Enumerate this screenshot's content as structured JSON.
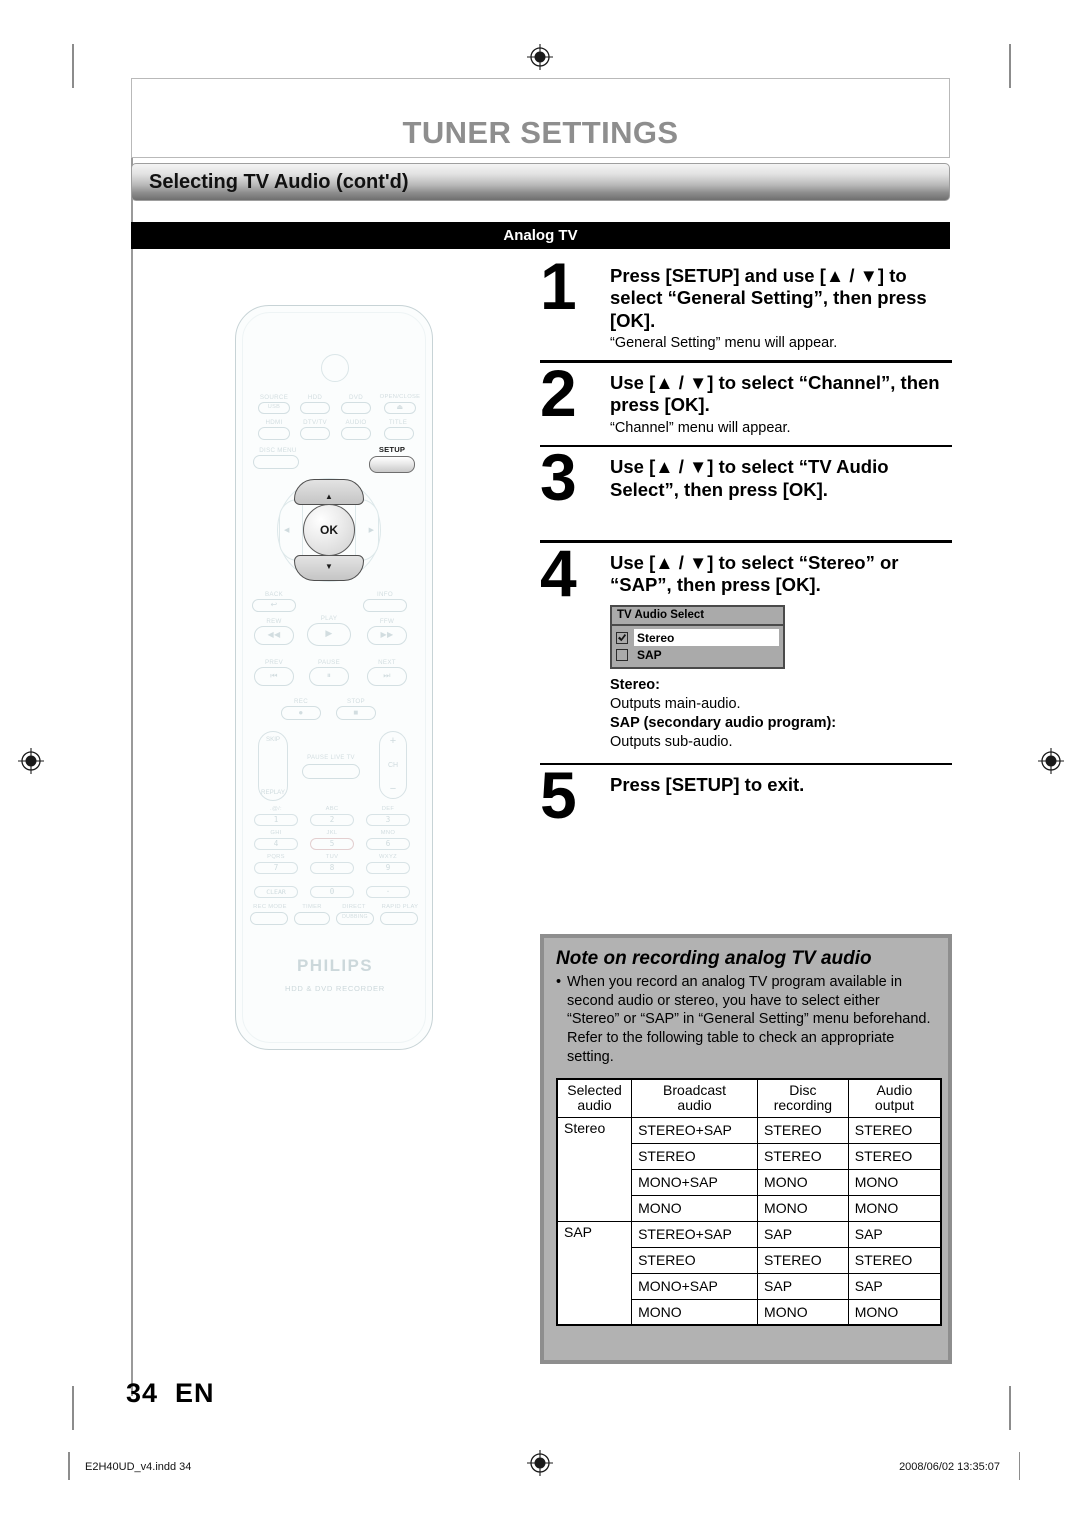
{
  "page": {
    "title": "TUNER SETTINGS",
    "subtitle": "Selecting TV Audio (cont'd)",
    "section": "Analog TV",
    "page_number": "34",
    "language_code": "EN"
  },
  "steps": [
    {
      "num": "1",
      "title": "Press [SETUP] and use [▲ / ▼] to select “General Setting”, then press [OK].",
      "sub": "“General Setting” menu will appear."
    },
    {
      "num": "2",
      "title": "Use [▲ / ▼] to select “Channel”, then press [OK].",
      "sub": "“Channel” menu will appear."
    },
    {
      "num": "3",
      "title": "Use [▲ / ▼] to select “TV Audio Select”, then press [OK].",
      "sub": ""
    },
    {
      "num": "4",
      "title": "Use [▲ / ▼] to select “Stereo” or “SAP”, then press [OK].",
      "sub": ""
    },
    {
      "num": "5",
      "title": "Press [SETUP] to exit.",
      "sub": ""
    }
  ],
  "osd": {
    "title": "TV Audio Select",
    "options": [
      {
        "label": "Stereo",
        "checked": true,
        "selected": true
      },
      {
        "label": "SAP",
        "checked": false,
        "selected": false
      }
    ]
  },
  "definitions": [
    {
      "term": "Stereo:",
      "desc": "Outputs main-audio."
    },
    {
      "term": "SAP (secondary audio program):",
      "desc": "Outputs sub-audio."
    }
  ],
  "note": {
    "title": "Note on recording analog TV audio",
    "bullet": "•",
    "text": "When you record an analog TV program available in second audio or stereo, you have to select either “Stereo” or “SAP” in “General Setting” menu beforehand. Refer to the following table to check an appropriate setting."
  },
  "chart_data": {
    "type": "table",
    "title": "Analog TV audio recording reference",
    "columns": [
      "Selected audio",
      "Broadcast audio",
      "Disc recording",
      "Audio output"
    ],
    "column_lines": [
      [
        "Selected",
        "audio"
      ],
      [
        "Broadcast",
        "audio"
      ],
      [
        "Disc",
        "recording"
      ],
      [
        "Audio",
        "output"
      ]
    ],
    "groups": [
      {
        "selected_audio": "Stereo",
        "rows": [
          {
            "broadcast": "STEREO+SAP",
            "disc": "STEREO",
            "output": "STEREO"
          },
          {
            "broadcast": "STEREO",
            "disc": "STEREO",
            "output": "STEREO"
          },
          {
            "broadcast": "MONO+SAP",
            "disc": "MONO",
            "output": "MONO"
          },
          {
            "broadcast": "MONO",
            "disc": "MONO",
            "output": "MONO"
          }
        ]
      },
      {
        "selected_audio": "SAP",
        "rows": [
          {
            "broadcast": "STEREO+SAP",
            "disc": "SAP",
            "output": "SAP"
          },
          {
            "broadcast": "STEREO",
            "disc": "STEREO",
            "output": "STEREO"
          },
          {
            "broadcast": "MONO+SAP",
            "disc": "SAP",
            "output": "SAP"
          },
          {
            "broadcast": "MONO",
            "disc": "MONO",
            "output": "MONO"
          }
        ]
      }
    ]
  },
  "remote": {
    "brand": "PHILIPS",
    "model_label": "HDD & DVD RECORDER",
    "power_label": "⏻",
    "buttons": {
      "source": "SOURCE",
      "usb": "USB",
      "hdd": "HDD",
      "dvd": "DVD",
      "open_close": "OPEN/CLOSE",
      "open_close_glyph": "⏏",
      "hdmi": "HDMI",
      "dtv_tv": "DTV/TV",
      "audio": "AUDIO",
      "title": "TITLE",
      "disc_menu": "DISC MENU",
      "setup": "SETUP",
      "ok": "OK",
      "up_arrow": "▲",
      "down_arrow": "▼",
      "left_arrow": "◀",
      "right_arrow": "▶",
      "back": "BACK",
      "back_glyph": "↩",
      "info": "INFO",
      "rew": "REW",
      "rew_glyph": "◀◀",
      "play": "PLAY",
      "play_glyph": "▶",
      "ffw": "FFW",
      "ffw_glyph": "▶▶",
      "prev": "PREV",
      "prev_glyph": "⏮",
      "pause": "PAUSE",
      "pause_glyph": "⏸",
      "next": "NEXT",
      "next_glyph": "⏭",
      "rec": "REC",
      "rec_glyph": "●",
      "stop": "STOP",
      "stop_glyph": "■",
      "skip": "SKIP",
      "replay": "REPLAY",
      "pause_live_tv": "PAUSE LIVE TV",
      "ch_plus": "+",
      "ch": "CH",
      "ch_minus": "−",
      "clear": "CLEAR",
      "rec_mode": "REC MODE",
      "timer": "TIMER",
      "direct": "DIRECT",
      "dubbing": "DUBBING",
      "rapid_play": "RAPID PLAY"
    },
    "keypad": [
      {
        "letters": ".@/:",
        "digit": "1"
      },
      {
        "letters": "ABC",
        "digit": "2"
      },
      {
        "letters": "DEF",
        "digit": "3"
      },
      {
        "letters": "GHI",
        "digit": "4"
      },
      {
        "letters": "JKL",
        "digit": "5"
      },
      {
        "letters": "MNO",
        "digit": "6"
      },
      {
        "letters": "PQRS",
        "digit": "7"
      },
      {
        "letters": "TUV",
        "digit": "8"
      },
      {
        "letters": "WXYZ",
        "digit": "9"
      },
      {
        "letters": "",
        "digit": "0"
      },
      {
        "letters": "",
        "digit": "·"
      }
    ]
  },
  "footer": {
    "file": "E2H40UD_v4.indd   34",
    "timestamp": "2008/06/02   13:35:07"
  }
}
